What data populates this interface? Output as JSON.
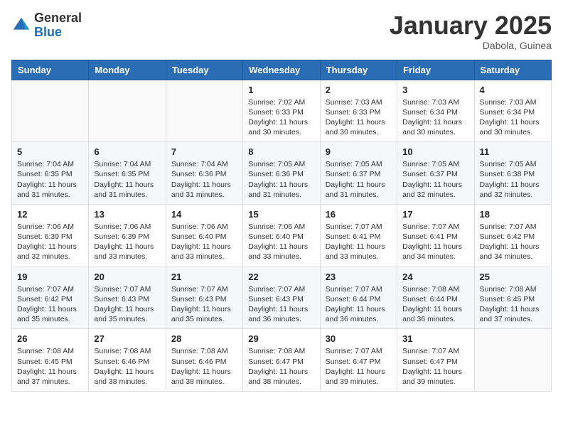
{
  "header": {
    "logo_general": "General",
    "logo_blue": "Blue",
    "month_title": "January 2025",
    "location": "Dabola, Guinea"
  },
  "weekdays": [
    "Sunday",
    "Monday",
    "Tuesday",
    "Wednesday",
    "Thursday",
    "Friday",
    "Saturday"
  ],
  "weeks": [
    [
      {
        "day": "",
        "sunrise": "",
        "sunset": "",
        "daylight": ""
      },
      {
        "day": "",
        "sunrise": "",
        "sunset": "",
        "daylight": ""
      },
      {
        "day": "",
        "sunrise": "",
        "sunset": "",
        "daylight": ""
      },
      {
        "day": "1",
        "sunrise": "Sunrise: 7:02 AM",
        "sunset": "Sunset: 6:33 PM",
        "daylight": "Daylight: 11 hours and 30 minutes."
      },
      {
        "day": "2",
        "sunrise": "Sunrise: 7:03 AM",
        "sunset": "Sunset: 6:33 PM",
        "daylight": "Daylight: 11 hours and 30 minutes."
      },
      {
        "day": "3",
        "sunrise": "Sunrise: 7:03 AM",
        "sunset": "Sunset: 6:34 PM",
        "daylight": "Daylight: 11 hours and 30 minutes."
      },
      {
        "day": "4",
        "sunrise": "Sunrise: 7:03 AM",
        "sunset": "Sunset: 6:34 PM",
        "daylight": "Daylight: 11 hours and 30 minutes."
      }
    ],
    [
      {
        "day": "5",
        "sunrise": "Sunrise: 7:04 AM",
        "sunset": "Sunset: 6:35 PM",
        "daylight": "Daylight: 11 hours and 31 minutes."
      },
      {
        "day": "6",
        "sunrise": "Sunrise: 7:04 AM",
        "sunset": "Sunset: 6:35 PM",
        "daylight": "Daylight: 11 hours and 31 minutes."
      },
      {
        "day": "7",
        "sunrise": "Sunrise: 7:04 AM",
        "sunset": "Sunset: 6:36 PM",
        "daylight": "Daylight: 11 hours and 31 minutes."
      },
      {
        "day": "8",
        "sunrise": "Sunrise: 7:05 AM",
        "sunset": "Sunset: 6:36 PM",
        "daylight": "Daylight: 11 hours and 31 minutes."
      },
      {
        "day": "9",
        "sunrise": "Sunrise: 7:05 AM",
        "sunset": "Sunset: 6:37 PM",
        "daylight": "Daylight: 11 hours and 31 minutes."
      },
      {
        "day": "10",
        "sunrise": "Sunrise: 7:05 AM",
        "sunset": "Sunset: 6:37 PM",
        "daylight": "Daylight: 11 hours and 32 minutes."
      },
      {
        "day": "11",
        "sunrise": "Sunrise: 7:05 AM",
        "sunset": "Sunset: 6:38 PM",
        "daylight": "Daylight: 11 hours and 32 minutes."
      }
    ],
    [
      {
        "day": "12",
        "sunrise": "Sunrise: 7:06 AM",
        "sunset": "Sunset: 6:39 PM",
        "daylight": "Daylight: 11 hours and 32 minutes."
      },
      {
        "day": "13",
        "sunrise": "Sunrise: 7:06 AM",
        "sunset": "Sunset: 6:39 PM",
        "daylight": "Daylight: 11 hours and 33 minutes."
      },
      {
        "day": "14",
        "sunrise": "Sunrise: 7:06 AM",
        "sunset": "Sunset: 6:40 PM",
        "daylight": "Daylight: 11 hours and 33 minutes."
      },
      {
        "day": "15",
        "sunrise": "Sunrise: 7:06 AM",
        "sunset": "Sunset: 6:40 PM",
        "daylight": "Daylight: 11 hours and 33 minutes."
      },
      {
        "day": "16",
        "sunrise": "Sunrise: 7:07 AM",
        "sunset": "Sunset: 6:41 PM",
        "daylight": "Daylight: 11 hours and 33 minutes."
      },
      {
        "day": "17",
        "sunrise": "Sunrise: 7:07 AM",
        "sunset": "Sunset: 6:41 PM",
        "daylight": "Daylight: 11 hours and 34 minutes."
      },
      {
        "day": "18",
        "sunrise": "Sunrise: 7:07 AM",
        "sunset": "Sunset: 6:42 PM",
        "daylight": "Daylight: 11 hours and 34 minutes."
      }
    ],
    [
      {
        "day": "19",
        "sunrise": "Sunrise: 7:07 AM",
        "sunset": "Sunset: 6:42 PM",
        "daylight": "Daylight: 11 hours and 35 minutes."
      },
      {
        "day": "20",
        "sunrise": "Sunrise: 7:07 AM",
        "sunset": "Sunset: 6:43 PM",
        "daylight": "Daylight: 11 hours and 35 minutes."
      },
      {
        "day": "21",
        "sunrise": "Sunrise: 7:07 AM",
        "sunset": "Sunset: 6:43 PM",
        "daylight": "Daylight: 11 hours and 35 minutes."
      },
      {
        "day": "22",
        "sunrise": "Sunrise: 7:07 AM",
        "sunset": "Sunset: 6:43 PM",
        "daylight": "Daylight: 11 hours and 36 minutes."
      },
      {
        "day": "23",
        "sunrise": "Sunrise: 7:07 AM",
        "sunset": "Sunset: 6:44 PM",
        "daylight": "Daylight: 11 hours and 36 minutes."
      },
      {
        "day": "24",
        "sunrise": "Sunrise: 7:08 AM",
        "sunset": "Sunset: 6:44 PM",
        "daylight": "Daylight: 11 hours and 36 minutes."
      },
      {
        "day": "25",
        "sunrise": "Sunrise: 7:08 AM",
        "sunset": "Sunset: 6:45 PM",
        "daylight": "Daylight: 11 hours and 37 minutes."
      }
    ],
    [
      {
        "day": "26",
        "sunrise": "Sunrise: 7:08 AM",
        "sunset": "Sunset: 6:45 PM",
        "daylight": "Daylight: 11 hours and 37 minutes."
      },
      {
        "day": "27",
        "sunrise": "Sunrise: 7:08 AM",
        "sunset": "Sunset: 6:46 PM",
        "daylight": "Daylight: 11 hours and 38 minutes."
      },
      {
        "day": "28",
        "sunrise": "Sunrise: 7:08 AM",
        "sunset": "Sunset: 6:46 PM",
        "daylight": "Daylight: 11 hours and 38 minutes."
      },
      {
        "day": "29",
        "sunrise": "Sunrise: 7:08 AM",
        "sunset": "Sunset: 6:47 PM",
        "daylight": "Daylight: 11 hours and 38 minutes."
      },
      {
        "day": "30",
        "sunrise": "Sunrise: 7:07 AM",
        "sunset": "Sunset: 6:47 PM",
        "daylight": "Daylight: 11 hours and 39 minutes."
      },
      {
        "day": "31",
        "sunrise": "Sunrise: 7:07 AM",
        "sunset": "Sunset: 6:47 PM",
        "daylight": "Daylight: 11 hours and 39 minutes."
      },
      {
        "day": "",
        "sunrise": "",
        "sunset": "",
        "daylight": ""
      }
    ]
  ]
}
